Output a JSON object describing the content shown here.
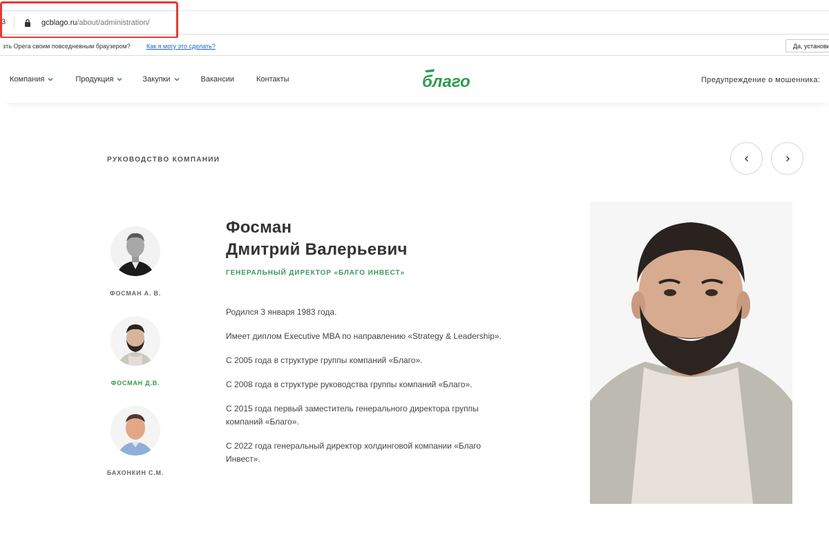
{
  "browser": {
    "url_host": "gcblago.ru",
    "url_path": "/about/administration/",
    "left_glyph": "3",
    "infobar_message": "зть Opera своим повседневным браузером?",
    "infobar_link": "Как я могу это сделать?",
    "infobar_button": "Да, установить"
  },
  "header": {
    "nav": [
      {
        "label": "Компания",
        "has_dropdown": true
      },
      {
        "label": "Продукция",
        "has_dropdown": true
      },
      {
        "label": "Закупки",
        "has_dropdown": true
      },
      {
        "label": "Вакансии",
        "has_dropdown": false
      },
      {
        "label": "Контакты",
        "has_dropdown": false
      }
    ],
    "logo_text": "благо",
    "fraud_warning": "Предупреждение о мошенника:"
  },
  "section": {
    "title": "РУКОВОДСТВО КОМПАНИИ"
  },
  "leaders": [
    {
      "short_name": "ФОСМАН А. В.",
      "active": false
    },
    {
      "short_name": "ФОСМАН Д.В.",
      "active": true
    },
    {
      "short_name": "БАХОНКИН С.М.",
      "active": false
    }
  ],
  "profile": {
    "surname": "Фосман",
    "given_names": "Дмитрий Валерьевич",
    "role": "ГЕНЕРАЛЬНЫЙ ДИРЕКТОР «БЛАГО ИНВЕСТ»",
    "bio": [
      "Родился 3 января 1983 года.",
      "Имеет диплом Executive MBA по направлению «Strategy & Leadership».",
      "С 2005 года в структуре группы компаний «Благо».",
      "С 2008 года в структуре руководства группы компаний «Благо».",
      "С 2015 года первый заместитель генерального директора группы компаний «Благо».",
      "С 2022 года генеральный директор холдинговой компании «Благо Инвест»."
    ]
  },
  "colors": {
    "accent_green": "#3a9a56",
    "highlight_red": "#e53935",
    "link_blue": "#1a6bc1"
  }
}
